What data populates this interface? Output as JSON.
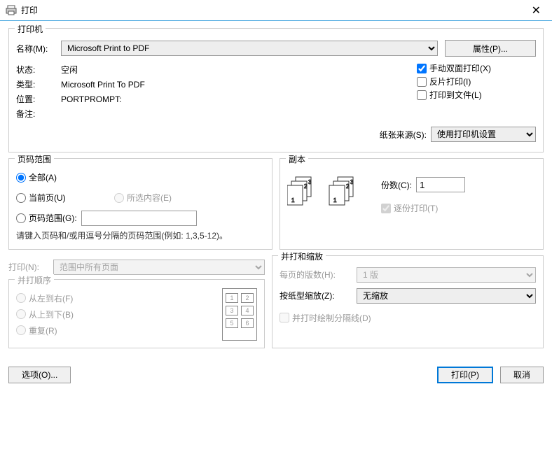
{
  "window": {
    "title": "打印"
  },
  "printer_group": {
    "legend": "打印机",
    "name_label": "名称(M):",
    "name_value": "Microsoft Print to PDF",
    "properties_btn": "属性(P)...",
    "status_label": "状态:",
    "status_value": "空闲",
    "type_label": "类型:",
    "type_value": "Microsoft Print To PDF",
    "location_label": "位置:",
    "location_value": "PORTPROMPT:",
    "comment_label": "备注:",
    "comment_value": "",
    "cb_duplex": "手动双面打印(X)",
    "cb_reverse": "反片打印(I)",
    "cb_tofile": "打印到文件(L)",
    "paper_source_label": "纸张来源(S):",
    "paper_source_value": "使用打印机设置"
  },
  "range_group": {
    "legend": "页码范围",
    "radio_all": "全部(A)",
    "radio_current": "当前页(U)",
    "radio_selection": "所选内容(E)",
    "radio_pages": "页码范围(G):",
    "pages_value": "",
    "hint": "请键入页码和/或用逗号分隔的页码范围(例如: 1,3,5-12)。"
  },
  "copies_group": {
    "legend": "副本",
    "copies_label": "份数(C):",
    "copies_value": "1",
    "collate_label": "逐份打印(T)"
  },
  "print_what": {
    "label": "打印(N):",
    "value": "范围中所有页面"
  },
  "order_group": {
    "legend": "并打顺序",
    "radio_ltr": "从左到右(F)",
    "radio_ttb": "从上到下(B)",
    "radio_repeat": "重复(R)"
  },
  "scale_group": {
    "legend": "并打和缩放",
    "pages_per_sheet_label": "每页的版数(H):",
    "pages_per_sheet_value": "1 版",
    "scale_label": "按纸型缩放(Z):",
    "scale_value": "无缩放",
    "cb_border": "并打时绘制分隔线(D)"
  },
  "buttons": {
    "options": "选项(O)...",
    "print": "打印(P)",
    "cancel": "取消"
  }
}
